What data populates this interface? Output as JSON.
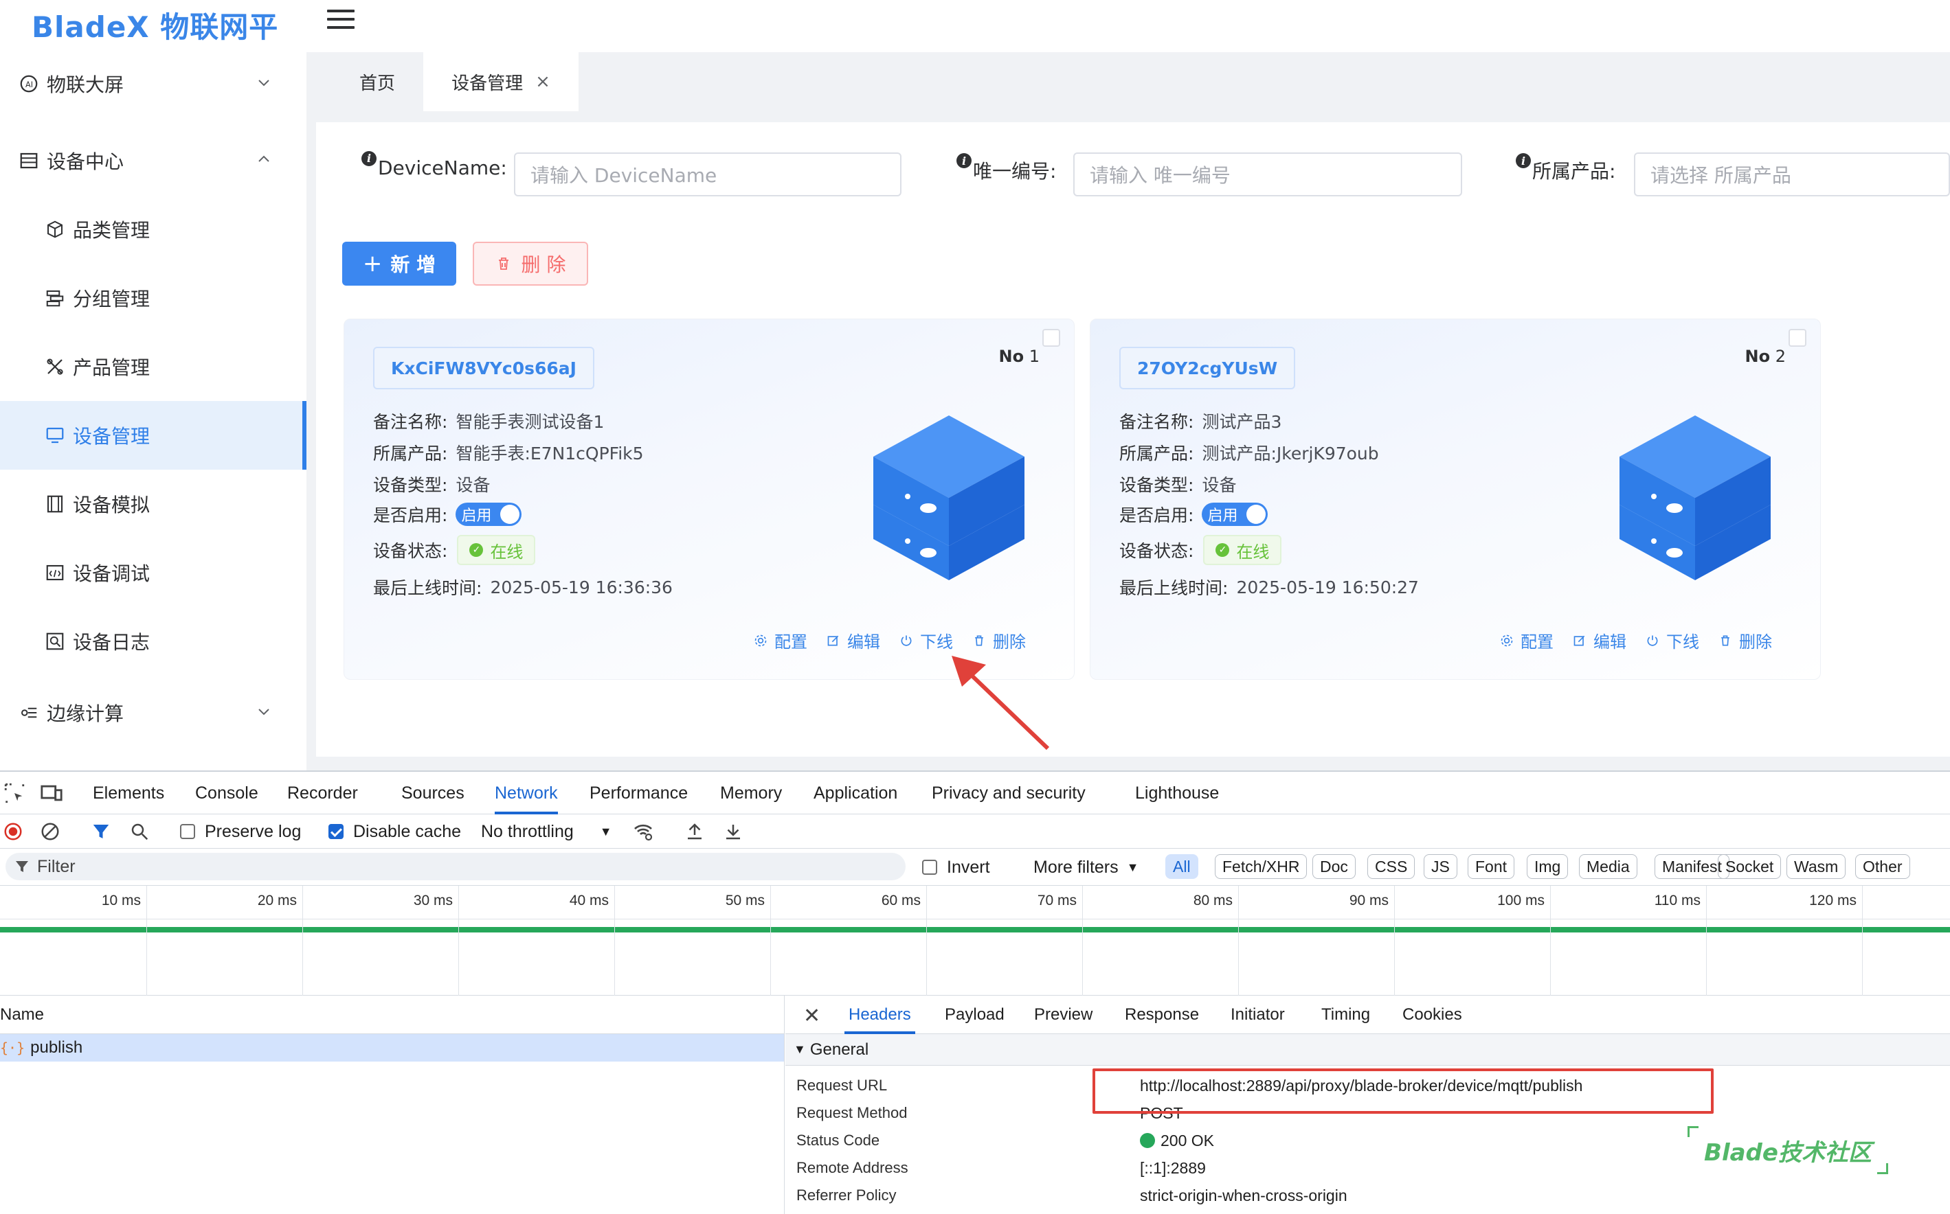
{
  "app": {
    "logo": "BladeX 物联网平台"
  },
  "sidebar": {
    "items": [
      {
        "label": "物联大屏"
      },
      {
        "label": "设备中心"
      },
      {
        "label": "品类管理"
      },
      {
        "label": "分组管理"
      },
      {
        "label": "产品管理"
      },
      {
        "label": "设备管理"
      },
      {
        "label": "设备模拟"
      },
      {
        "label": "设备调试"
      },
      {
        "label": "设备日志"
      },
      {
        "label": "边缘计算"
      }
    ]
  },
  "tabs": [
    {
      "label": "首页"
    },
    {
      "label": "设备管理"
    }
  ],
  "search": {
    "device_name_label": "DeviceName:",
    "device_name_placeholder": "请输入 DeviceName",
    "unique_label": "唯一编号:",
    "unique_placeholder": "请输入 唯一编号",
    "product_label": "所属产品:",
    "product_placeholder": "请选择 所属产品"
  },
  "toolbar": {
    "add_label": "新 增",
    "delete_label": "删 除"
  },
  "cards": [
    {
      "code": "KxCiFW8VYc0s66aJ",
      "no_prefix": "No",
      "no": "1",
      "remark_label": "备注名称:",
      "remark": "智能手表测试设备1",
      "product_label": "所属产品:",
      "product": "智能手表:E7N1cQPFik5",
      "type_label": "设备类型:",
      "type": "设备",
      "enabled_label": "是否启用:",
      "enabled": "启用",
      "status_label": "设备状态:",
      "status": "在线",
      "last_online_label": "最后上线时间:",
      "last_online": "2025-05-19 16:36:36",
      "actions": [
        "配置",
        "编辑",
        "下线",
        "删除"
      ]
    },
    {
      "code": "27OY2cgYUsW",
      "no_prefix": "No",
      "no": "2",
      "remark_label": "备注名称:",
      "remark": "测试产品3",
      "product_label": "所属产品:",
      "product": "测试产品:JkerjK97oub",
      "type_label": "设备类型:",
      "type": "设备",
      "enabled_label": "是否启用:",
      "enabled": "启用",
      "status_label": "设备状态:",
      "status": "在线",
      "last_online_label": "最后上线时间:",
      "last_online": "2025-05-19 16:50:27",
      "actions": [
        "配置",
        "编辑",
        "下线",
        "删除"
      ]
    }
  ],
  "devtools": {
    "tabs": [
      "Elements",
      "Console",
      "Recorder",
      "Sources",
      "Network",
      "Performance",
      "Memory",
      "Application",
      "Privacy and security",
      "Lighthouse"
    ],
    "toolbar": {
      "preserve_log": "Preserve log",
      "disable_cache": "Disable cache",
      "throttling": "No throttling"
    },
    "filter": {
      "placeholder": "Filter",
      "invert": "Invert",
      "more_filters": "More filters",
      "types": [
        "All",
        "Fetch/XHR",
        "Doc",
        "CSS",
        "JS",
        "Font",
        "Img",
        "Media",
        "Manifest",
        "Socket",
        "Wasm",
        "Other"
      ]
    },
    "timeline_ticks": [
      "10 ms",
      "20 ms",
      "30 ms",
      "40 ms",
      "50 ms",
      "60 ms",
      "70 ms",
      "80 ms",
      "90 ms",
      "100 ms",
      "110 ms",
      "120 ms"
    ],
    "request_list": {
      "header": "Name",
      "rows": [
        {
          "name": "publish"
        }
      ]
    },
    "detail": {
      "tabs": [
        "Headers",
        "Payload",
        "Preview",
        "Response",
        "Initiator",
        "Timing",
        "Cookies"
      ],
      "section": "General",
      "rows": [
        {
          "key": "Request URL",
          "value": "http://localhost:2889/api/proxy/blade-broker/device/mqtt/publish"
        },
        {
          "key": "Request Method",
          "value": "POST"
        },
        {
          "key": "Status Code",
          "value": "200 OK"
        },
        {
          "key": "Remote Address",
          "value": "[::1]:2889"
        },
        {
          "key": "Referrer Policy",
          "value": "strict-origin-when-cross-origin"
        }
      ]
    }
  },
  "watermark": "Blade技术社区",
  "colors": {
    "primary": "#3b87f0",
    "danger": "#f56c6c",
    "success": "#67c23a",
    "devtools_accent": "#1a66d2",
    "annotation_red": "#e0413a"
  }
}
